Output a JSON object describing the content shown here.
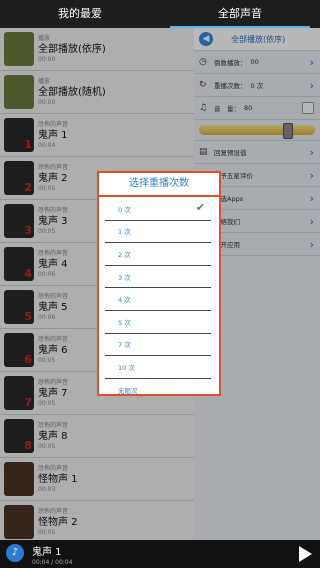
{
  "tabs": {
    "favorites": "我的最爱",
    "all_sounds": "全部声音"
  },
  "list": [
    {
      "category": "播放",
      "name": "全部播放(依序)",
      "duration": "00:00",
      "kind": "green",
      "num": ""
    },
    {
      "category": "播放",
      "name": "全部播放(随机)",
      "duration": "00:00",
      "kind": "green",
      "num": ""
    },
    {
      "category": "恐怖的声音",
      "name": "鬼声 1",
      "duration": "00:04",
      "kind": "dark",
      "num": "1"
    },
    {
      "category": "恐怖的声音",
      "name": "鬼声 2",
      "duration": "00:05",
      "kind": "dark",
      "num": "2"
    },
    {
      "category": "恐怖的声音",
      "name": "鬼声 3",
      "duration": "00:05",
      "kind": "dark",
      "num": "3"
    },
    {
      "category": "恐怖的声音",
      "name": "鬼声 4",
      "duration": "00:06",
      "kind": "dark",
      "num": "4"
    },
    {
      "category": "恐怖的声音",
      "name": "鬼声 5",
      "duration": "00:06",
      "kind": "dark",
      "num": "5"
    },
    {
      "category": "恐怖的声音",
      "name": "鬼声 6",
      "duration": "00:05",
      "kind": "dark",
      "num": "6"
    },
    {
      "category": "恐怖的声音",
      "name": "鬼声 7",
      "duration": "00:05",
      "kind": "dark",
      "num": "7"
    },
    {
      "category": "恐怖的声音",
      "name": "鬼声 8",
      "duration": "00:05",
      "kind": "dark",
      "num": "8"
    },
    {
      "category": "恐怖的声音",
      "name": "怪物声 1",
      "duration": "00:03",
      "kind": "brown",
      "num": ""
    },
    {
      "category": "恐怖的声音",
      "name": "怪物声 2",
      "duration": "00:05",
      "kind": "brown",
      "num": ""
    }
  ],
  "panel": {
    "title": "全部播放(依序)",
    "countdown": "倒数播放：",
    "countdown_value": "00",
    "repeat": "重播次数：",
    "repeat_value": "0 次",
    "volume": "音　量：",
    "volume_value": "80",
    "volume_level": 0.78,
    "restore": "回复预设值",
    "rate": "给予五星评价",
    "apps": "精选Apps",
    "contact": "联络我们",
    "leave": "离开应用"
  },
  "dialog": {
    "title": "选择重播次数",
    "options": [
      "0 次",
      "1 次",
      "2 次",
      "3 次",
      "4 次",
      "5 次",
      "7 次",
      "10 次",
      "无限次"
    ],
    "selected": "0 次"
  },
  "player": {
    "track": "鬼声 1",
    "time": "00:04 / 00:04"
  }
}
